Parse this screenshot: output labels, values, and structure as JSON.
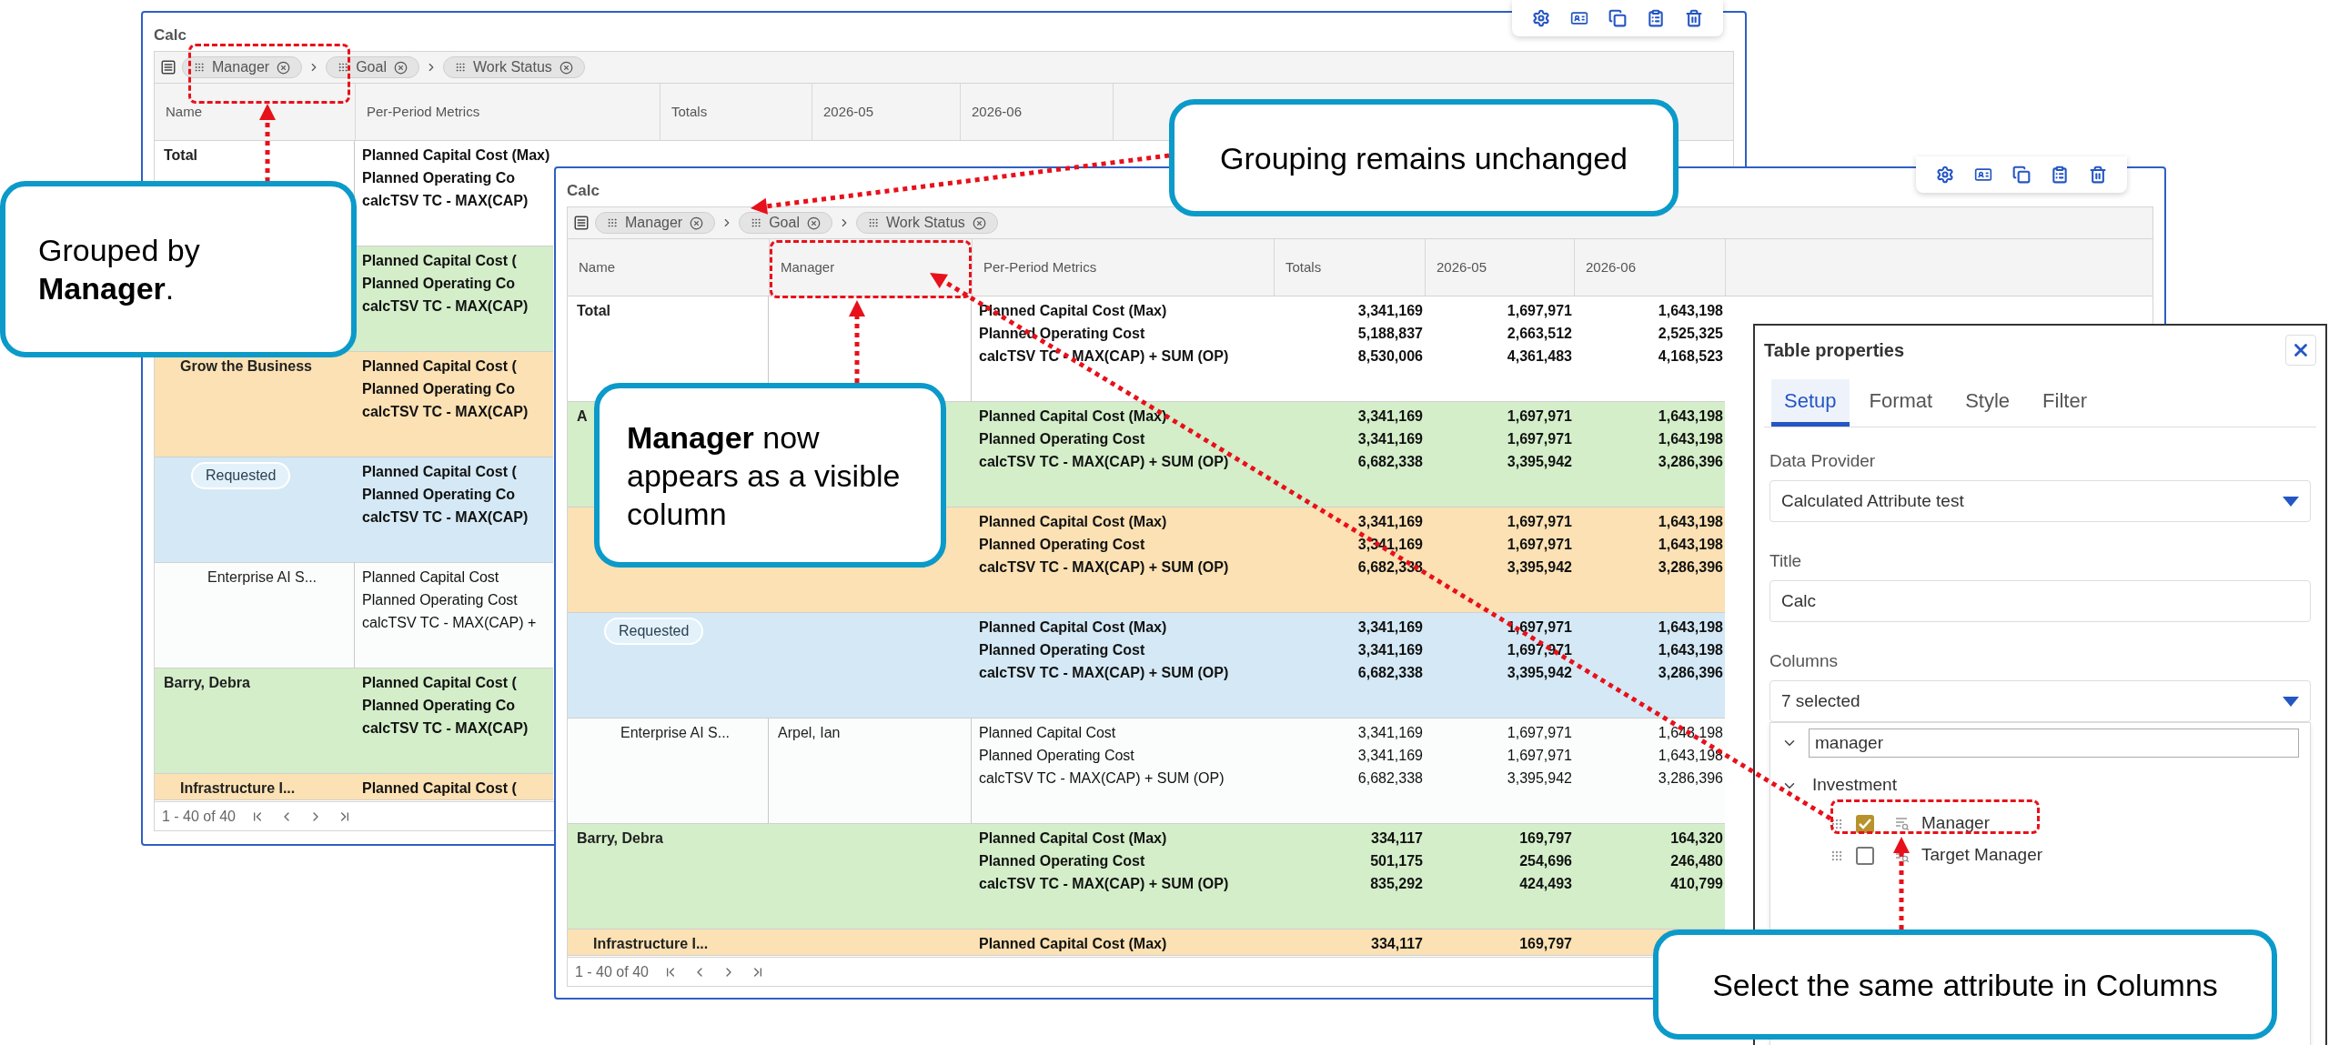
{
  "back_window": {
    "title": "Calc",
    "group_chips": [
      "Manager",
      "Goal",
      "Work Status"
    ],
    "columns": [
      {
        "label": "Name",
        "kind": "name"
      },
      {
        "label": "Per-Period Metrics",
        "kind": "metrics"
      },
      {
        "label": "Totals",
        "kind": "value"
      },
      {
        "label": "2026-05",
        "kind": "value"
      },
      {
        "label": "2026-06",
        "kind": "value"
      }
    ],
    "rows": [
      {
        "kind": "total",
        "name": "Total",
        "lines": [
          {
            "metric": "Planned Capital Cost (Max)"
          },
          {
            "metric": "Planned Operating Co"
          },
          {
            "metric": "calcTSV TC - MAX(CAP)"
          }
        ]
      },
      {
        "kind": "manager",
        "lines": [
          {
            "metric": "Planned Capital Cost ("
          },
          {
            "metric": "Planned Operating Co"
          },
          {
            "metric": "calcTSV TC - MAX(CAP)"
          }
        ]
      },
      {
        "kind": "goal",
        "name": "Grow the Business",
        "lines": [
          {
            "metric": "Planned Capital Cost ("
          },
          {
            "metric": "Planned Operating Co"
          },
          {
            "metric": "calcTSV TC - MAX(CAP)"
          }
        ]
      },
      {
        "kind": "status",
        "name": "Requested",
        "lines": [
          {
            "metric": "Planned Capital Cost ("
          },
          {
            "metric": "Planned Operating Co"
          },
          {
            "metric": "calcTSV TC - MAX(CAP)"
          }
        ]
      },
      {
        "kind": "item",
        "name": "Enterprise AI S...",
        "lines": [
          {
            "metric": "Planned Capital Cost"
          },
          {
            "metric": "Planned Operating Cost"
          },
          {
            "metric": "calcTSV TC - MAX(CAP) +"
          }
        ]
      },
      {
        "kind": "manager",
        "name": "Barry, Debra",
        "lines": [
          {
            "metric": "Planned Capital Cost ("
          },
          {
            "metric": "Planned Operating Co"
          },
          {
            "metric": "calcTSV TC - MAX(CAP)"
          }
        ]
      },
      {
        "kind": "goal",
        "name": "Infrastructure I...",
        "lines": [
          {
            "metric": "Planned Capital Cost ("
          }
        ]
      }
    ],
    "pagination": "1 - 40 of 40"
  },
  "front_window": {
    "title": "Calc",
    "group_chips": [
      "Manager",
      "Goal",
      "Work Status"
    ],
    "columns": [
      {
        "label": "Name",
        "kind": "name"
      },
      {
        "label": "Manager",
        "kind": "attribute"
      },
      {
        "label": "Per-Period Metrics",
        "kind": "metrics"
      },
      {
        "label": "Totals",
        "kind": "value"
      },
      {
        "label": "2026-05",
        "kind": "value"
      },
      {
        "label": "2026-06",
        "kind": "value"
      }
    ],
    "rows": [
      {
        "kind": "total",
        "name": "Total",
        "lines": [
          {
            "metric": "Planned Capital Cost (Max)",
            "values": [
              "3,341,169",
              "1,697,971",
              "1,643,198"
            ]
          },
          {
            "metric": "Planned Operating Cost",
            "values": [
              "5,188,837",
              "2,663,512",
              "2,525,325"
            ]
          },
          {
            "metric": "calcTSV TC - MAX(CAP) + SUM (OP)",
            "values": [
              "8,530,006",
              "4,361,483",
              "4,168,523"
            ]
          }
        ]
      },
      {
        "kind": "manager",
        "name": "A",
        "lines": [
          {
            "metric": "Planned Capital Cost (Max)",
            "values": [
              "3,341,169",
              "1,697,971",
              "1,643,198"
            ]
          },
          {
            "metric": "Planned Operating Cost",
            "values": [
              "3,341,169",
              "1,697,971",
              "1,643,198"
            ]
          },
          {
            "metric": "calcTSV TC - MAX(CAP) + SUM (OP)",
            "values": [
              "6,682,338",
              "3,395,942",
              "3,286,396"
            ]
          }
        ]
      },
      {
        "kind": "goal",
        "lines": [
          {
            "metric": "Planned Capital Cost (Max)",
            "values": [
              "3,341,169",
              "1,697,971",
              "1,643,198"
            ]
          },
          {
            "metric": "Planned Operating Cost",
            "values": [
              "3,341,169",
              "1,697,971",
              "1,643,198"
            ]
          },
          {
            "metric": "calcTSV TC - MAX(CAP) + SUM (OP)",
            "values": [
              "6,682,338",
              "3,395,942",
              "3,286,396"
            ]
          }
        ]
      },
      {
        "kind": "status",
        "name": "Requested",
        "lines": [
          {
            "metric": "Planned Capital Cost (Max)",
            "values": [
              "3,341,169",
              "1,697,971",
              "1,643,198"
            ]
          },
          {
            "metric": "Planned Operating Cost",
            "values": [
              "3,341,169",
              "1,697,971",
              "1,643,198"
            ]
          },
          {
            "metric": "calcTSV TC - MAX(CAP) + SUM (OP)",
            "values": [
              "6,682,338",
              "3,395,942",
              "3,286,396"
            ]
          }
        ]
      },
      {
        "kind": "item",
        "name": "Enterprise AI S...",
        "manager": "Arpel, Ian",
        "lines": [
          {
            "metric": "Planned Capital Cost",
            "values": [
              "3,341,169",
              "1,697,971",
              "1,643,198"
            ]
          },
          {
            "metric": "Planned Operating Cost",
            "values": [
              "3,341,169",
              "1,697,971",
              "1,643,198"
            ]
          },
          {
            "metric": "calcTSV TC - MAX(CAP) + SUM (OP)",
            "values": [
              "6,682,338",
              "3,395,942",
              "3,286,396"
            ]
          }
        ]
      },
      {
        "kind": "manager",
        "name": "Barry, Debra",
        "lines": [
          {
            "metric": "Planned Capital Cost (Max)",
            "values": [
              "334,117",
              "169,797",
              "164,320"
            ]
          },
          {
            "metric": "Planned Operating Cost",
            "values": [
              "501,175",
              "254,696",
              "246,480"
            ]
          },
          {
            "metric": "calcTSV TC - MAX(CAP) + SUM (OP)",
            "values": [
              "835,292",
              "424,493",
              "410,799"
            ]
          }
        ]
      },
      {
        "kind": "goal",
        "name": "Infrastructure I...",
        "lines": [
          {
            "metric": "Planned Capital Cost (Max)",
            "values": [
              "334,117",
              "169,797"
            ]
          }
        ]
      }
    ],
    "pagination": "1 - 40 of 40"
  },
  "table_properties": {
    "title": "Table properties",
    "tabs": [
      {
        "label": "Setup",
        "selected": true
      },
      {
        "label": "Format",
        "selected": false
      },
      {
        "label": "Style",
        "selected": false
      },
      {
        "label": "Filter",
        "selected": false
      }
    ],
    "fields": [
      {
        "label": "Data Provider",
        "value": "Calculated Attribute test",
        "kind": "select"
      },
      {
        "label": "Title",
        "value": "Calc",
        "kind": "text"
      },
      {
        "label": "Columns",
        "value": "7 selected",
        "kind": "select"
      }
    ],
    "column_search": {
      "value": "manager"
    },
    "column_tree": {
      "label": "Investment",
      "expanded": true,
      "children": [
        {
          "label": "Manager",
          "checked": true
        },
        {
          "label": "Target Manager",
          "checked": false
        }
      ]
    }
  },
  "callouts": [
    {
      "text": "Grouped by **Manager**."
    },
    {
      "text": "Grouping remains unchanged"
    },
    {
      "text": "**Manager** now appears as a visible column"
    },
    {
      "text": "Select the same attribute in Columns"
    }
  ]
}
